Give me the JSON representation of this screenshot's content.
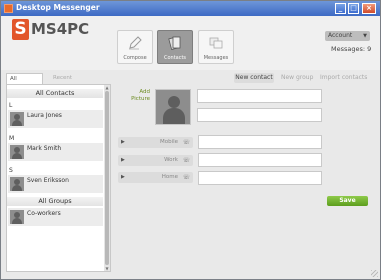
{
  "window": {
    "title": "Desktop Messenger"
  },
  "window_controls": {
    "minimize": "_",
    "maximize": "□",
    "close": "×"
  },
  "logo": {
    "letter": "S",
    "text": "MS4PC"
  },
  "toolbar": {
    "compose_label": "Compose",
    "contacts_label": "Contacts",
    "messages_label": "Messages"
  },
  "account": {
    "selected": "Account",
    "arrow": "▼"
  },
  "messages_count": "Messages: 9",
  "left_tabs": {
    "all_contacts": "All Contacts",
    "recent_activity": "Recent Activity"
  },
  "contacts_section": "All Contacts",
  "groups_section": "All Groups",
  "contacts": [
    {
      "letter": "L",
      "name": "Laura Jones"
    },
    {
      "letter": "M",
      "name": "Mark Smith"
    },
    {
      "letter": "S",
      "name": "Sven Eriksson"
    }
  ],
  "groups": [
    {
      "name": "Co-workers"
    }
  ],
  "right_tabs": {
    "new_contact": "New contact",
    "new_group": "New group",
    "import_contacts": "Import contacts"
  },
  "form": {
    "add_picture": "Add Picture",
    "phones": [
      {
        "label": "Mobile"
      },
      {
        "label": "Work"
      },
      {
        "label": "Home"
      }
    ],
    "save_label": "Save"
  },
  "scroll": {
    "up": "▲",
    "down": "▼"
  },
  "colors": {
    "titlebar": "#3d6ac4",
    "brand": "#e2552a",
    "save": "#6aa82a"
  }
}
